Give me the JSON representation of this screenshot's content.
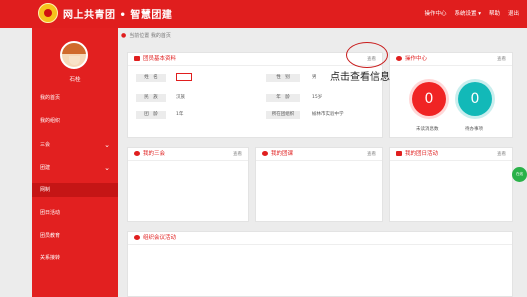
{
  "header": {
    "title": "网上共青团 • 智慧团建",
    "nav": [
      "操作中心",
      "系统设置 ▾",
      "帮助",
      "退出"
    ]
  },
  "sidebar": {
    "username": "石桂",
    "items": [
      {
        "label": "我的首页",
        "chevron": ""
      },
      {
        "label": "我的组织",
        "chevron": ""
      },
      {
        "label": "三会",
        "chevron": "⌄"
      },
      {
        "label": "团建",
        "chevron": "⌄"
      },
      {
        "label": "网制",
        "chevron": ""
      },
      {
        "label": "团日活动",
        "chevron": ""
      },
      {
        "label": "团员教育",
        "chevron": ""
      },
      {
        "label": "关系接转",
        "chevron": ""
      }
    ]
  },
  "breadcrumb": "当前位置 我的首页",
  "profile": {
    "title": "团员基本资料",
    "view_link": "查看",
    "fields": {
      "name_label": "姓　名",
      "name_value": "",
      "gender_label": "性　别",
      "gender_value": "男",
      "ethnic_label": "民　族",
      "ethnic_value": "汉族",
      "age_label": "年　龄",
      "age_value": "15岁",
      "league_age_label": "团　龄",
      "league_age_value": "1年",
      "org_label": "所在团组织",
      "org_value": "榆林市实验中学"
    }
  },
  "ops": {
    "title": "操作中心",
    "view_link": "查看",
    "unread_count": "0",
    "unread_label": "未读消息数",
    "todo_count": "0",
    "todo_label": "待办事项"
  },
  "panels": {
    "three_meetings": {
      "title": "我的三会",
      "view_link": "查看"
    },
    "my_class": {
      "title": "我的团课",
      "view_link": "查看"
    },
    "league_day": {
      "title": "我的团日活动",
      "view_link": "查看"
    },
    "org_activity": {
      "title": "组织会议活动"
    }
  },
  "annotation": "点击查看信息",
  "float_button": "在线"
}
